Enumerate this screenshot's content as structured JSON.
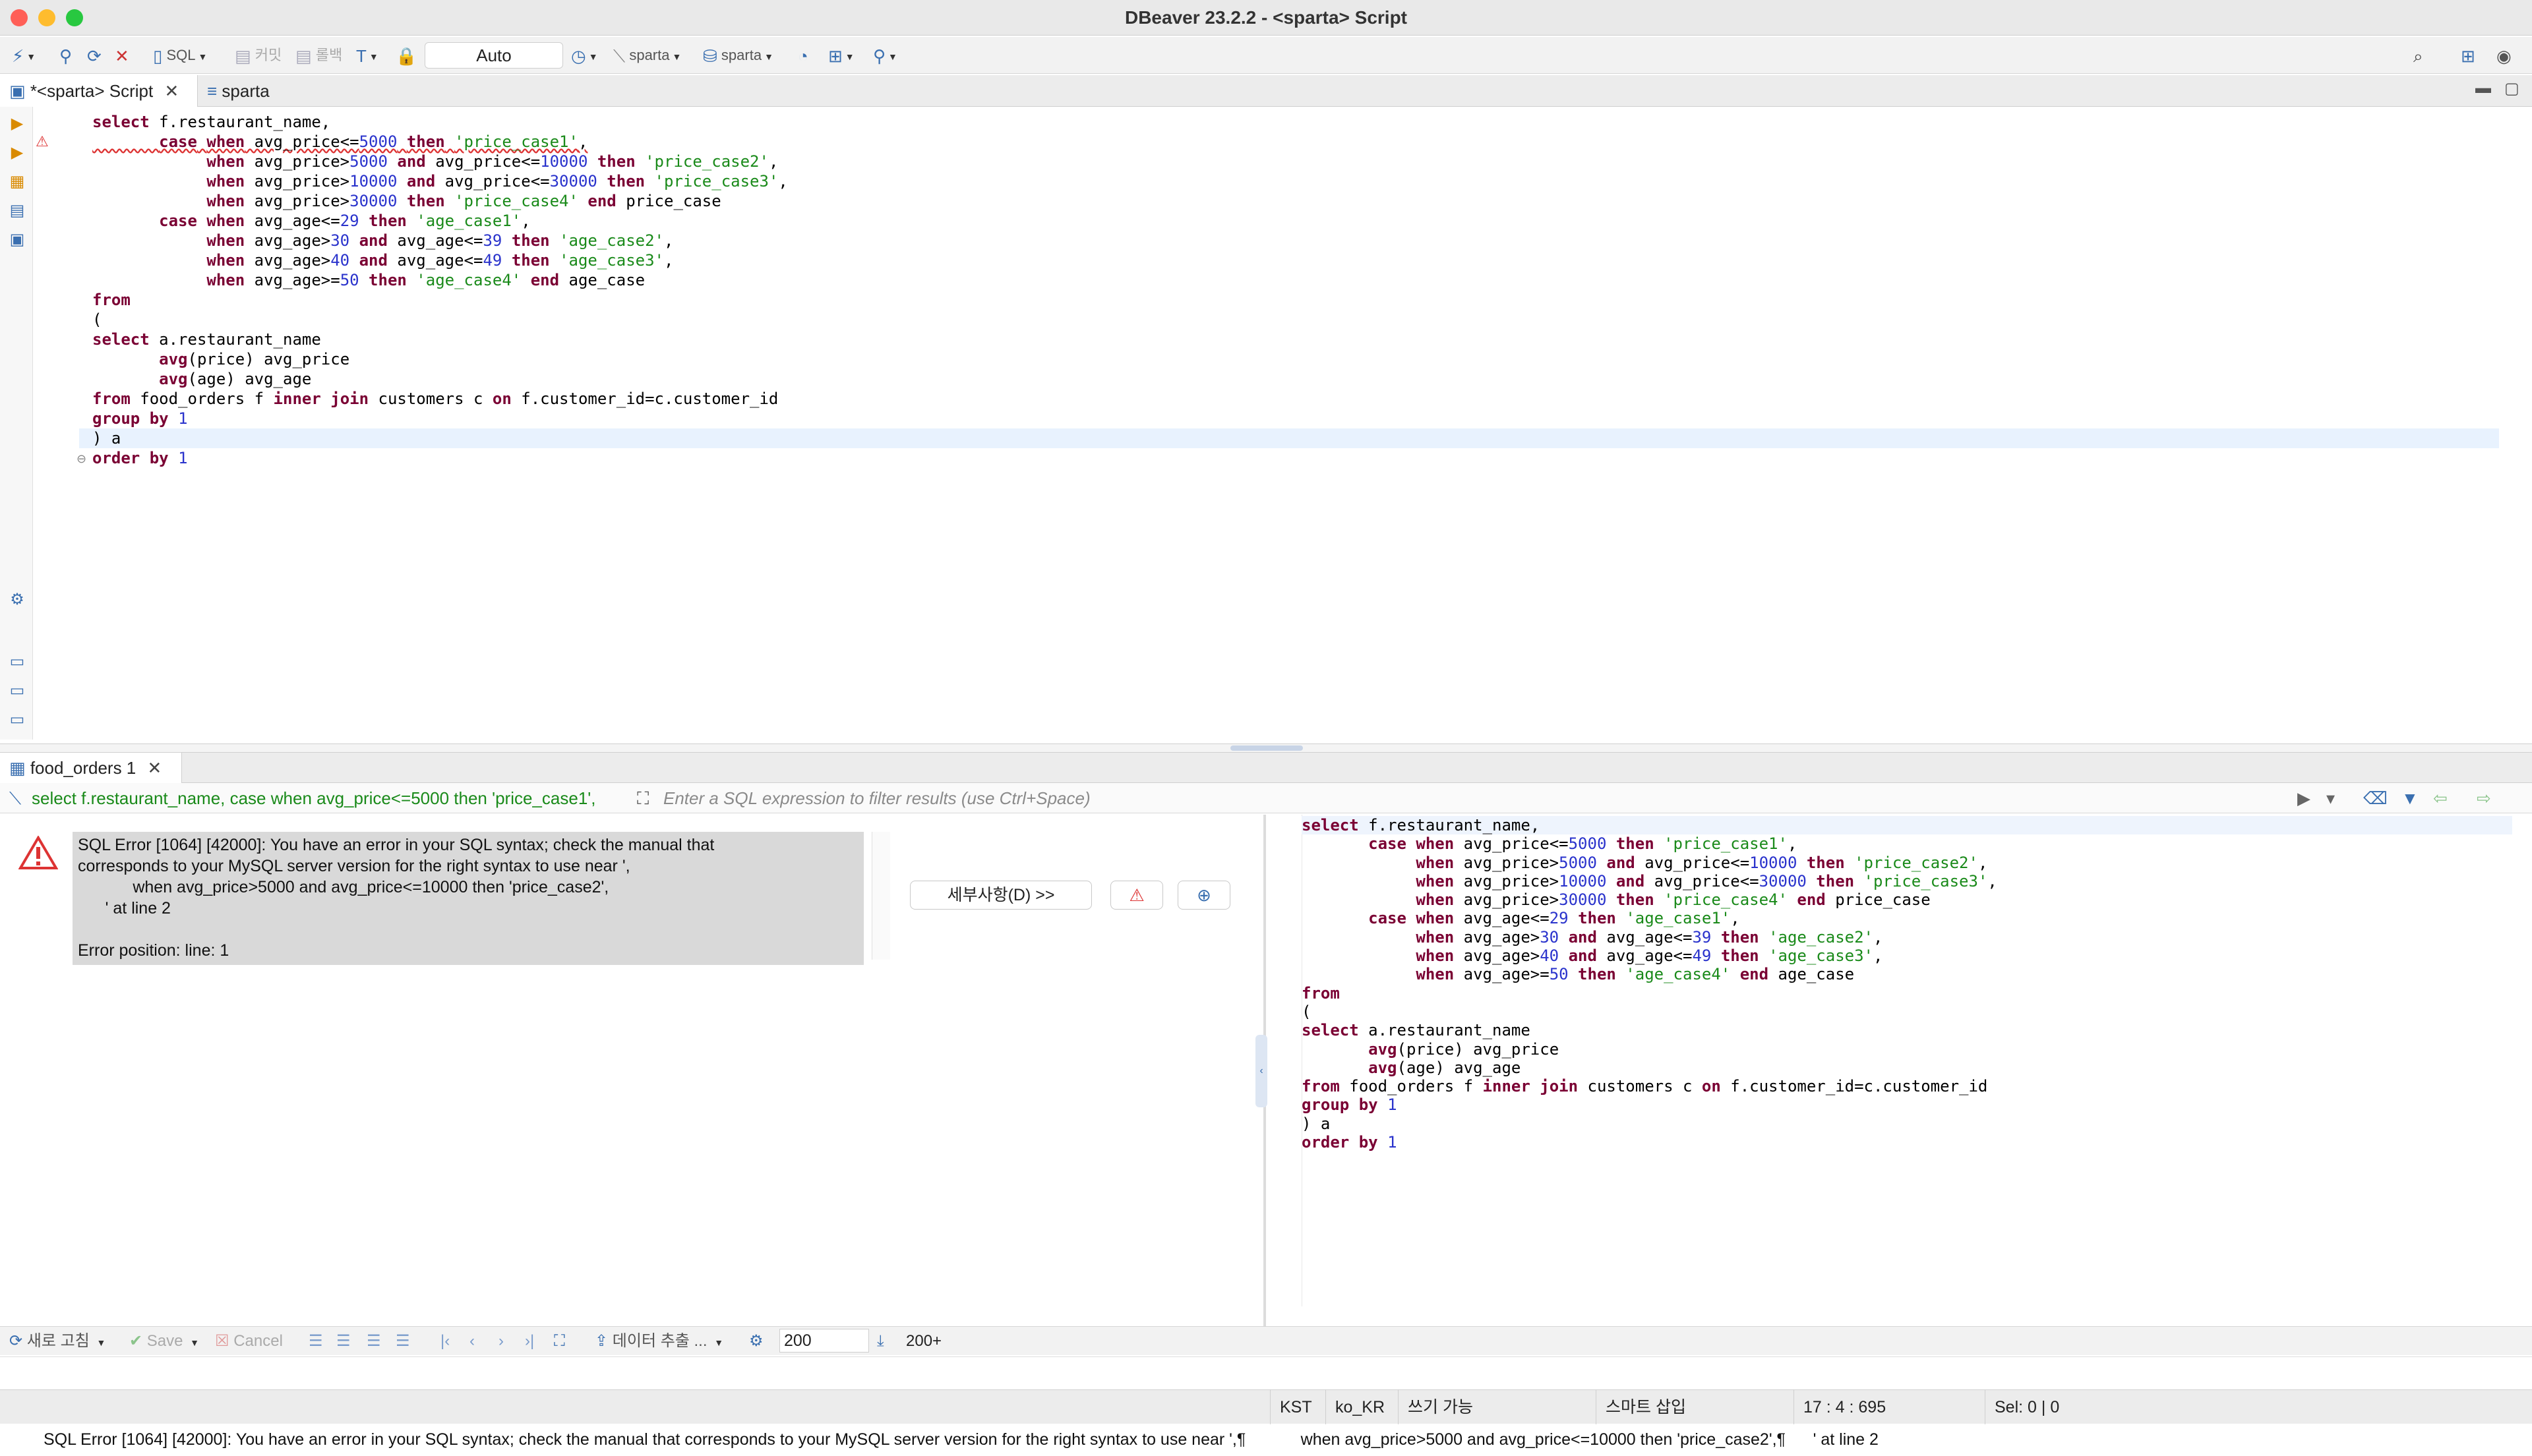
{
  "window": {
    "title": "DBeaver 23.2.2 - <sparta> Script"
  },
  "colors": {
    "close": "#ff5f57",
    "minimize": "#febc2e",
    "maximize": "#28c840",
    "keyword": "#7a0033",
    "number": "#2a33cc",
    "string": "#1a8a1a",
    "error": "#d33"
  },
  "toolbar": {
    "sql_label": "SQL",
    "commit_label": "커밋",
    "rollback_label": "롤백",
    "transaction_mode": "Auto",
    "datasource": "sparta",
    "schema": "sparta"
  },
  "editor_tabs": [
    {
      "label": "*<sparta> Script",
      "icon": "sql-script-icon"
    },
    {
      "label": "sparta",
      "icon": "sql-console-icon"
    }
  ],
  "code_lines": [
    "select f.restaurant_name,",
    "       case when avg_price<=5000 then 'price_case1',",
    "            when avg_price>5000 and avg_price<=10000 then 'price_case2',",
    "            when avg_price>10000 and avg_price<=30000 then 'price_case3',",
    "            when avg_price>30000 then 'price_case4' end price_case",
    "       case when avg_age<=29 then 'age_case1',",
    "            when avg_age>30 and avg_age<=39 then 'age_case2',",
    "            when avg_age>40 and avg_age<=49 then 'age_case3',",
    "            when avg_age>=50 then 'age_case4' end age_case",
    "from",
    "(",
    "select a.restaurant_name",
    "       avg(price) avg_price",
    "       avg(age) avg_age",
    "from food_orders f inner join customers c on f.customer_id=c.customer_id",
    "group by 1",
    ") a",
    "order by 1"
  ],
  "results": {
    "tab_label": "food_orders 1",
    "query_preview": "select f.restaurant_name, case when avg_price<=5000 then 'price_case1',",
    "filter_placeholder": "Enter a SQL expression to filter results (use Ctrl+Space)",
    "error_message": "SQL Error [1064] [42000]: You have an error in your SQL syntax; check the manual that\ncorresponds to your MySQL server version for the right syntax to use near ',\n            when avg_price>5000 and avg_price<=10000 then 'price_case2',\n      ' at line 2",
    "error_position": "Error position: line: 1",
    "details_button": "세부사항(D) >>"
  },
  "bottom_toolbar": {
    "refresh": "새로 고침",
    "save": "Save",
    "cancel": "Cancel",
    "export": "데이터 추출 ...",
    "fetch_size": "200",
    "fetch_all": "200+"
  },
  "message_bar": "SQL Error [1064] [42000]: You have an error in your SQL syntax; check the manual that corresponds to your MySQL server version for the right syntax to use near ',¶            when avg_price>5000 and avg_price<=10000 then 'price_case2',¶      ' at line 2",
  "status_bar": {
    "timezone": "KST",
    "locale": "ko_KR",
    "write_mode": "쓰기 가능",
    "insert_mode": "스마트 삽입",
    "cursor_pos": "17 : 4 : 695",
    "selection": "Sel: 0 | 0"
  }
}
